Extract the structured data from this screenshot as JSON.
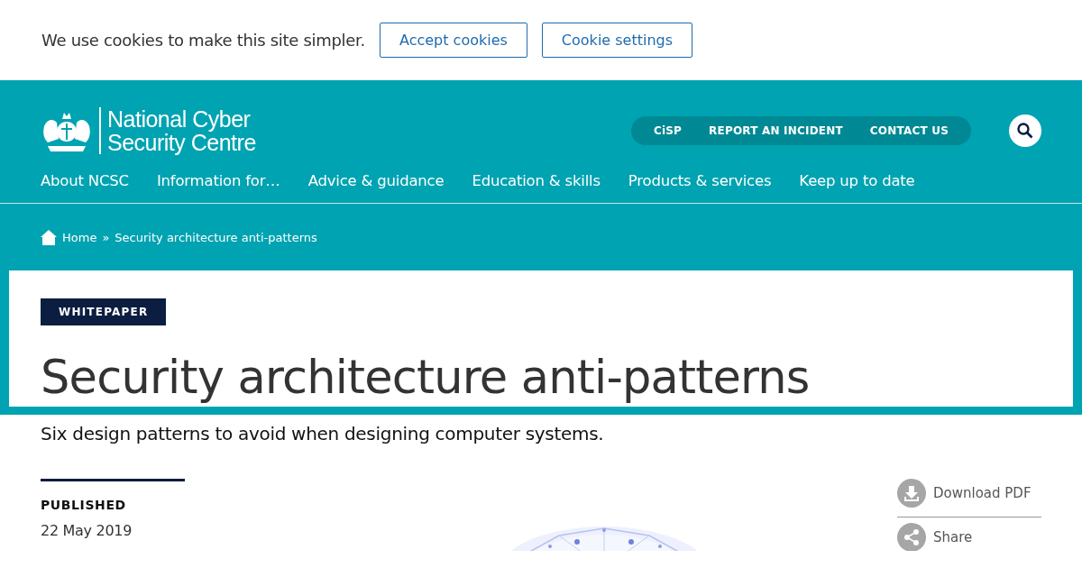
{
  "cookie_banner": {
    "message": "We use cookies to make this site simpler.",
    "buttons": [
      "Accept cookies",
      "Cookie settings"
    ]
  },
  "header": {
    "logo_lines": [
      "National Cyber",
      "Security Centre"
    ],
    "utility_links": [
      "CiSP",
      "REPORT AN INCIDENT",
      "CONTACT US"
    ],
    "nav": [
      "About NCSC",
      "Information for…",
      "Advice & guidance",
      "Education & skills",
      "Products & services",
      "Keep up to date"
    ]
  },
  "breadcrumb": [
    "Home",
    "»",
    "Security architecture anti-patterns"
  ],
  "article": {
    "tag": "WHITEPAPER",
    "title": "Security architecture anti-patterns",
    "summary": "Six design patterns to avoid when designing computer systems.",
    "published_label": "PUBLISHED",
    "published_date": "22 May 2019",
    "actions": [
      {
        "kind": "download",
        "label": "Download PDF"
      },
      {
        "kind": "share",
        "label": "Share"
      }
    ]
  }
}
